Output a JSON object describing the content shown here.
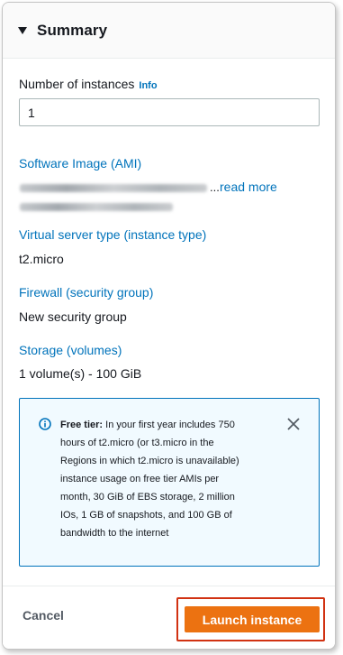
{
  "summary": {
    "title": "Summary"
  },
  "instances": {
    "label": "Number of instances",
    "info_link": "Info",
    "value": "1"
  },
  "ami": {
    "label": "Software Image (AMI)",
    "ellipsis": "...",
    "read_more": "read more"
  },
  "instance_type": {
    "label": "Virtual server type (instance type)",
    "value": "t2.micro"
  },
  "firewall": {
    "label": "Firewall (security group)",
    "value": "New security group"
  },
  "storage": {
    "label": "Storage (volumes)",
    "value": "1 volume(s) - 100 GiB"
  },
  "free_tier_alert": {
    "title": "Free tier:",
    "lines": [
      "In your first year includes 750",
      "hours of t2.micro (or t3.micro in the",
      "Regions in which t2.micro is unavailable)",
      "instance usage on free tier AMIs per",
      "month, 30 GiB of EBS storage, 2 million",
      "IOs, 1 GB of snapshots, and 100 GB of",
      "bandwidth to the internet"
    ]
  },
  "footer": {
    "cancel_label": "Cancel",
    "launch_label": "Launch instance"
  },
  "colors": {
    "link": "#0073bb",
    "primary_button": "#ec7211",
    "highlight_outline": "#d13212",
    "alert_background": "#f1faff"
  },
  "icons": {
    "collapse": "caret-down-icon",
    "info": "info-circle-icon",
    "close": "close-icon"
  }
}
